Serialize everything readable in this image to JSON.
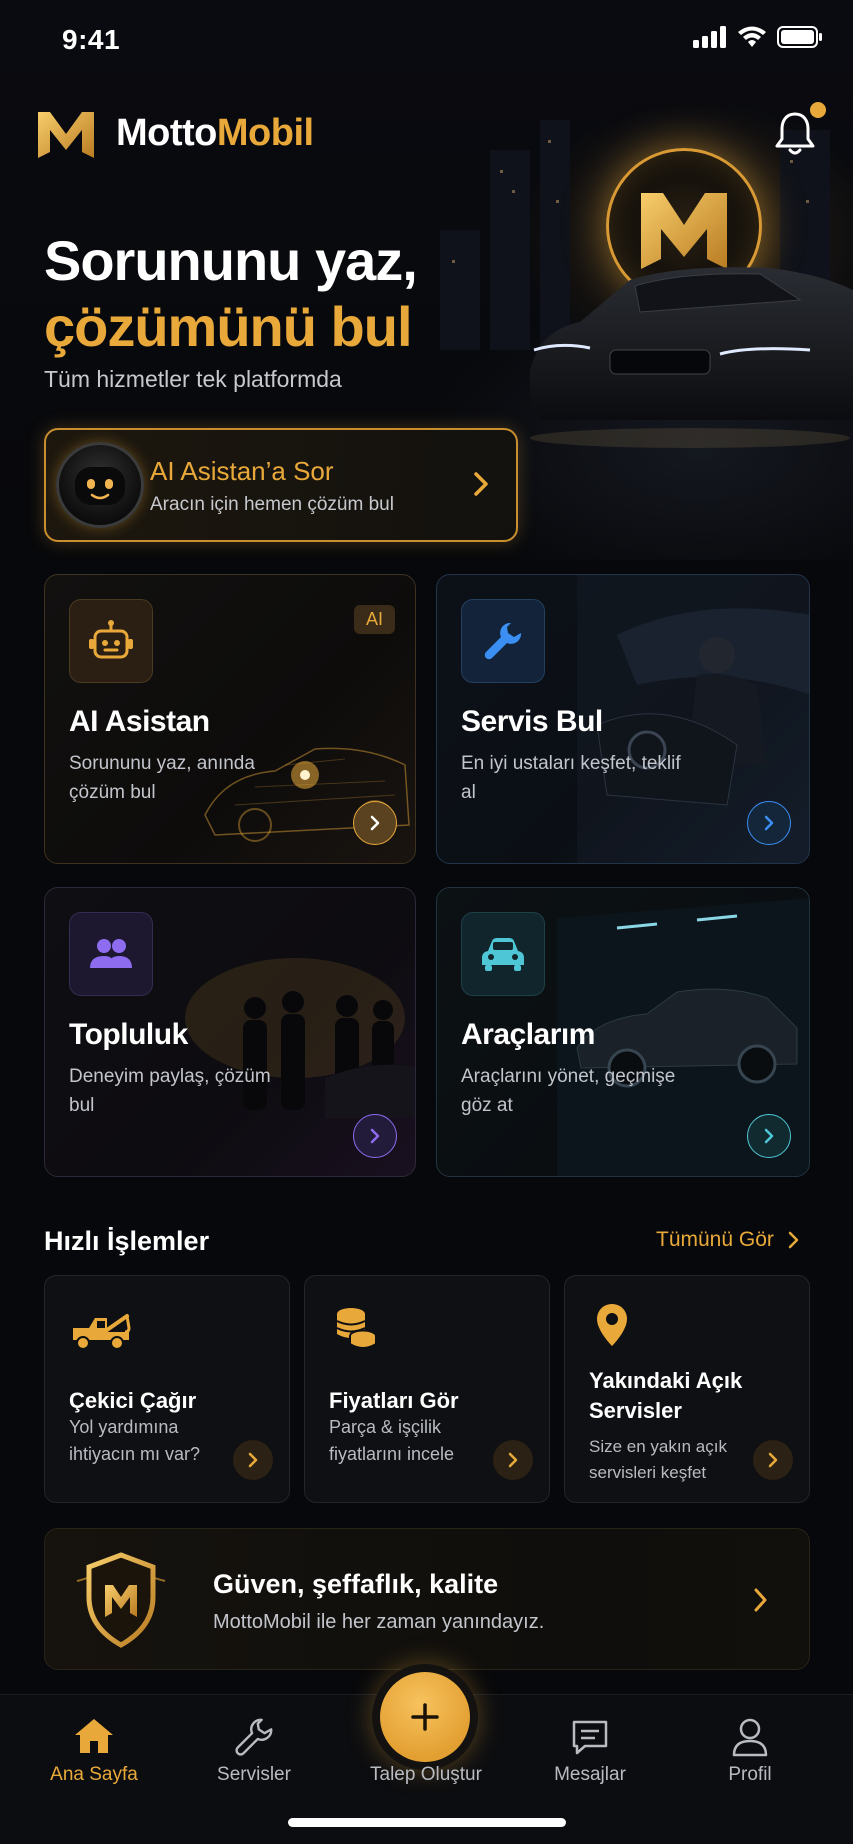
{
  "status_bar": {
    "time": "9:41"
  },
  "header": {
    "brand_part1": "Motto",
    "brand_part2": "Mobil",
    "notification_dot": true
  },
  "hero": {
    "title_line1": "Sorununu yaz,",
    "title_line2": "çözümünü bul",
    "subtitle": "Tüm hizmetler tek platformda"
  },
  "ai_prompt": {
    "title": "AI Asistan’a Sor",
    "subtitle": "Aracın için hemen çözüm bul"
  },
  "feature_cards": [
    {
      "title": "AI Asistan",
      "subtitle": "Sorununu yaz, anında çözüm bul",
      "badge": "AI",
      "icon": "robot-icon",
      "accent": "#e9a93a"
    },
    {
      "title": "Servis Bul",
      "subtitle": "En iyi ustaları keşfet, teklif al",
      "icon": "wrench-icon",
      "accent": "#3b8ff3"
    },
    {
      "title": "Topluluk",
      "subtitle": "Deneyim paylaş, çözüm bul",
      "icon": "users-icon",
      "accent": "#8d6cf0"
    },
    {
      "title": "Araçlarım",
      "subtitle": "Araçlarını yönet, geçmişe göz at",
      "icon": "car-icon",
      "accent": "#4fc6d6"
    }
  ],
  "quick_actions": {
    "title": "Hızlı İşlemler",
    "see_all": "Tümünü Gör",
    "items": [
      {
        "title": "Çekici Çağır",
        "subtitle": "Yol yardımına ihtiyacın mı var?",
        "icon": "tow-truck-icon"
      },
      {
        "title": "Fiyatları Gör",
        "subtitle": "Parça & işçilik fiyatlarını incele",
        "icon": "coins-icon"
      },
      {
        "title": "Yakındaki Açık Servisler",
        "subtitle": "Size en yakın açık servisleri keşfet",
        "icon": "map-pin-icon"
      }
    ]
  },
  "trust_banner": {
    "title": "Güven, şeffaflık, kalite",
    "subtitle": "MottoMobil ile her zaman yanındayız."
  },
  "tab_bar": {
    "items": [
      {
        "label": "Ana Sayfa",
        "icon": "home-icon",
        "active": true
      },
      {
        "label": "Servisler",
        "icon": "wrench-icon",
        "active": false
      },
      {
        "label": "Talep Oluştur",
        "icon": "plus-icon",
        "active": false
      },
      {
        "label": "Mesajlar",
        "icon": "message-icon",
        "active": false
      },
      {
        "label": "Profil",
        "icon": "user-icon",
        "active": false
      }
    ]
  },
  "colors": {
    "accent_gold": "#e9a93a",
    "background": "#07080b",
    "blue": "#3b8ff3",
    "purple": "#8d6cf0",
    "teal": "#4fc6d6"
  }
}
